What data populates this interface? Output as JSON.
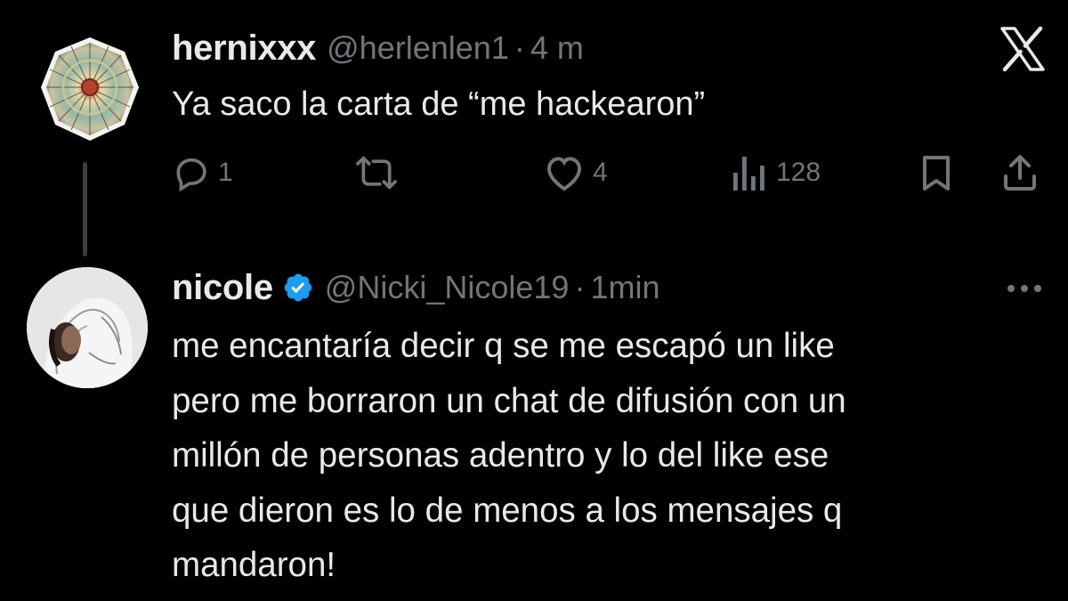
{
  "tweet1": {
    "display_name": "hernixxx",
    "handle": "@herlenlen1",
    "separator": "·",
    "time": "4 m",
    "text": "Ya saco la carta de “me hackearon”",
    "replies": "1",
    "likes": "4",
    "views": "128",
    "icons": [
      "reply-icon",
      "retweet-icon",
      "like-icon",
      "views-icon",
      "bookmark-icon",
      "share-icon"
    ]
  },
  "tweet2": {
    "display_name": "nicole",
    "handle": "@Nicki_Nicole19",
    "separator": "·",
    "time": "1min",
    "verified": true,
    "text_lines": [
      "me encantaría decir q se me escapó un like",
      "pero me borraron un chat de difusión con un",
      "millón de personas adentro y lo del like ese",
      "que dieron es lo de menos a los mensajes q",
      "mandaron!"
    ]
  },
  "colors": {
    "background": "#000000",
    "text": "#e7e9ea",
    "muted": "#71767b",
    "verified_blue": "#1d9bf0",
    "thread_line": "#3a3f44"
  }
}
